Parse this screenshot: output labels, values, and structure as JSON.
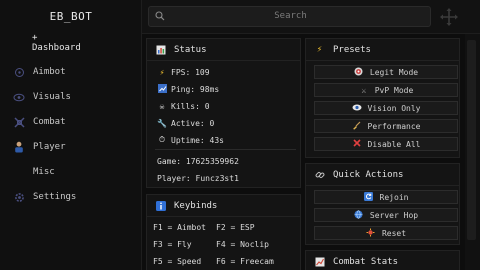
{
  "sidebar": {
    "title": "EB_BOT",
    "items": [
      {
        "label": "+\nDashboard",
        "icon": "plus-icon"
      },
      {
        "label": "Aimbot",
        "icon": "crosshair-icon"
      },
      {
        "label": "Visuals",
        "icon": "eye-icon"
      },
      {
        "label": "Combat",
        "icon": "combat-icon"
      },
      {
        "label": "Player",
        "icon": "player-icon"
      },
      {
        "label": "Misc",
        "icon": "misc-icon"
      },
      {
        "label": "Settings",
        "icon": "gear-icon"
      }
    ]
  },
  "search": {
    "placeholder": "Search"
  },
  "status": {
    "title": "Status",
    "fps": "FPS: 109",
    "ping": "Ping: 98ms",
    "kills": "Kills: 0",
    "active": "Active: 0",
    "uptime": "Uptime: 43s",
    "game": "Game: 17625359962",
    "player": "Player: Funcz3st1"
  },
  "presets": {
    "title": "Presets",
    "buttons": [
      "Legit Mode",
      "PvP Mode",
      "Vision Only",
      "Performance",
      "Disable All"
    ]
  },
  "quick_actions": {
    "title": "Quick Actions",
    "buttons": [
      "Rejoin",
      "Server Hop",
      "Reset"
    ]
  },
  "keybinds": {
    "title": "Keybinds",
    "rows": [
      [
        "F1 = Aimbot",
        "F2 = ESP"
      ],
      [
        "F3 = Fly",
        "F4 = Noclip"
      ],
      [
        "F5 = Speed",
        "F6 = Freecam"
      ]
    ]
  },
  "combat_stats": {
    "title": "Combat Stats"
  },
  "colors": {
    "accent": "#4a4f80",
    "panel": "#141414",
    "background": "#0d0d0d"
  }
}
